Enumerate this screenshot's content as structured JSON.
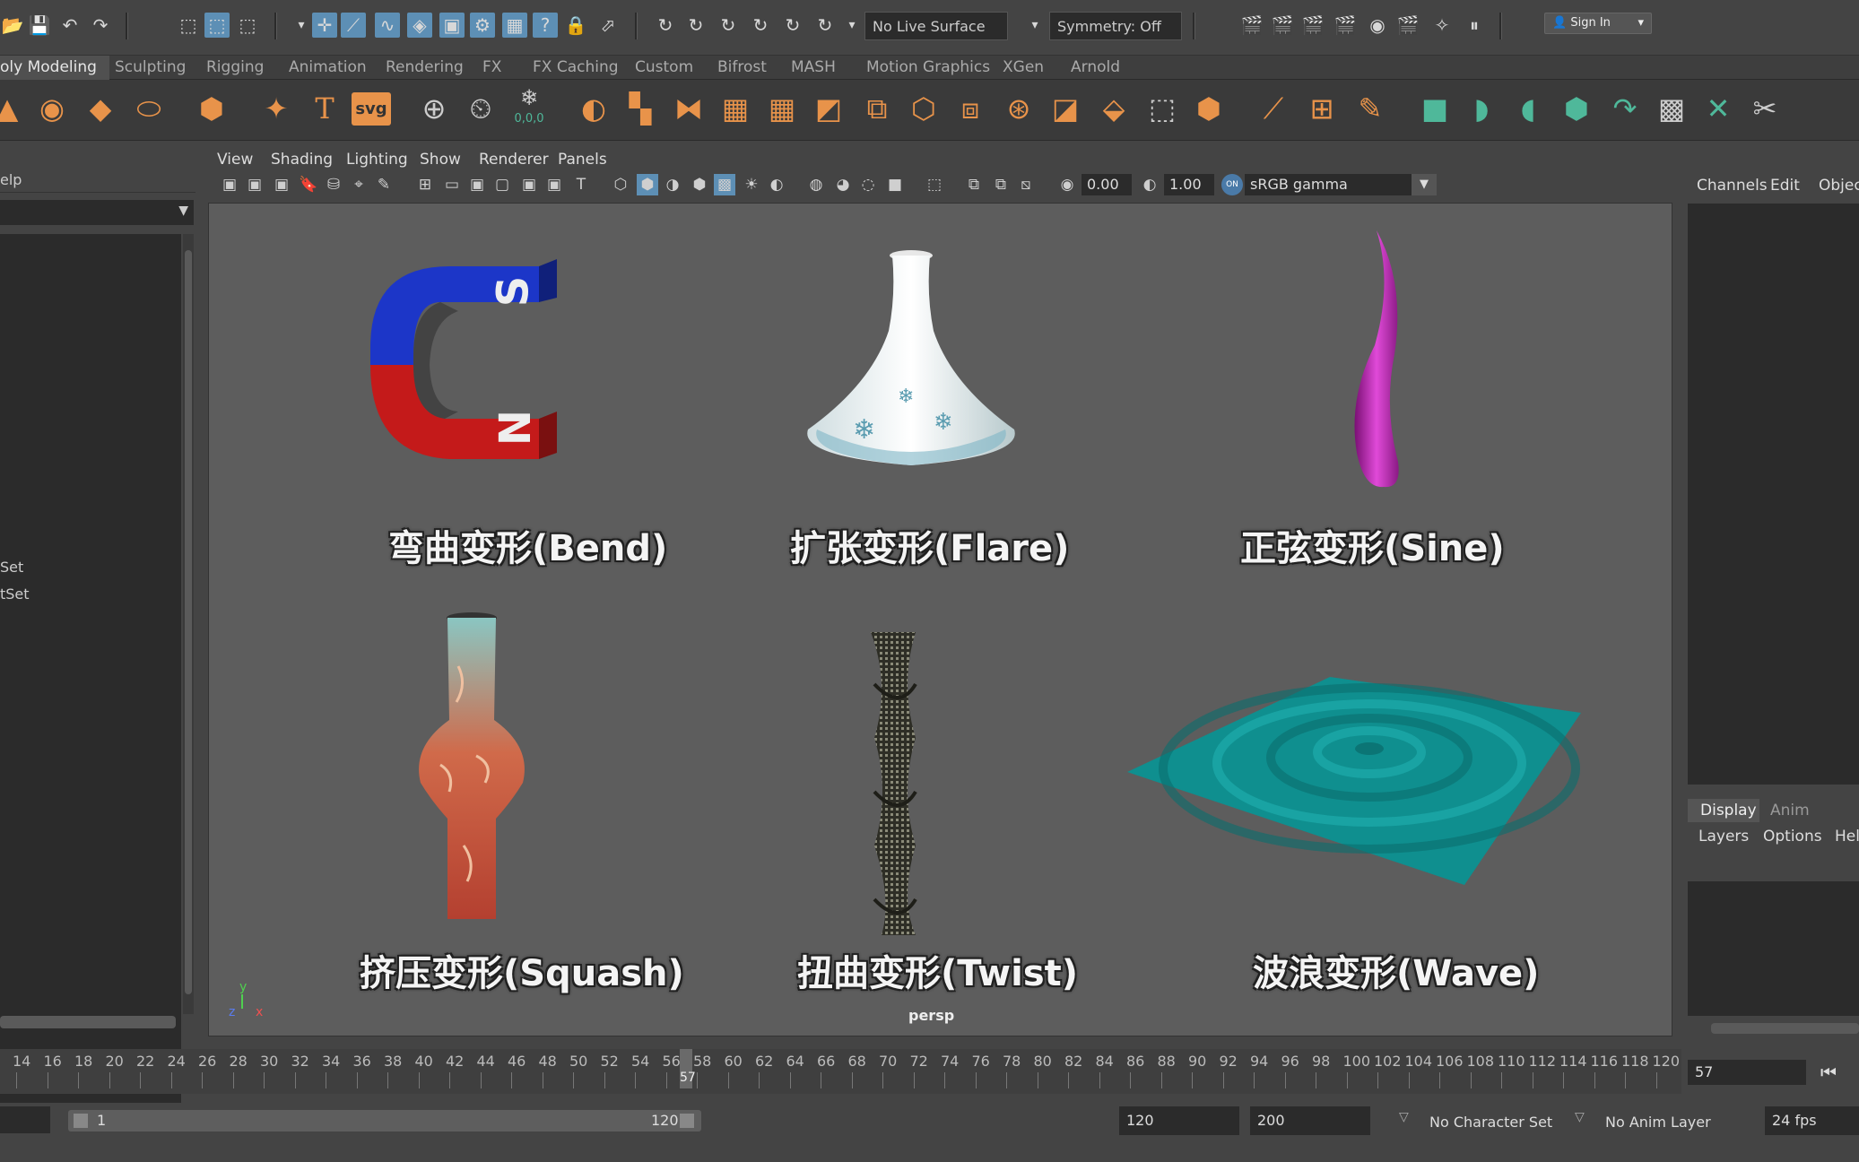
{
  "toolbar": {
    "live_surface": "No Live Surface",
    "symmetry": "Symmetry: Off",
    "sign_in": "Sign In"
  },
  "shelf_tabs": [
    "oly Modeling",
    "Sculpting",
    "Rigging",
    "Animation",
    "Rendering",
    "FX",
    "FX Caching",
    "Custom",
    "Bifrost",
    "MASH",
    "Motion Graphics",
    "XGen",
    "Arnold"
  ],
  "shelf_svg_label": "svg",
  "shelf_snowflake_value": "0,0,0",
  "left_panel": {
    "menu": "elp",
    "item1": "Set",
    "item2": "tSet"
  },
  "viewport": {
    "menus": [
      "View",
      "Shading",
      "Lighting",
      "Show",
      "Renderer",
      "Panels"
    ],
    "exposure": "0.00",
    "gamma": "1.00",
    "color_space": "sRGB gamma",
    "on_label": "ON",
    "camera": "persp",
    "axis_y": "y",
    "axis_z": "z",
    "axis_x": "x"
  },
  "deformers": {
    "bend": "弯曲变形(Bend)",
    "flare": "扩张变形(Flare)",
    "sine": "正弦变形(Sine)",
    "squash": "挤压变形(Squash)",
    "twist": "扭曲变形(Twist)",
    "wave": "波浪变形(Wave)"
  },
  "magnet": {
    "s": "S",
    "n": "N"
  },
  "channel_box": {
    "tabs": [
      "Channels",
      "Edit",
      "Objec"
    ]
  },
  "layer_editor": {
    "tabs": [
      "Display",
      "Anim"
    ],
    "menus": [
      "Layers",
      "Options",
      "Help"
    ]
  },
  "timeline": {
    "ticks": [
      "14",
      "16",
      "18",
      "20",
      "22",
      "24",
      "26",
      "28",
      "30",
      "32",
      "34",
      "36",
      "38",
      "40",
      "42",
      "44",
      "46",
      "48",
      "50",
      "52",
      "54",
      "56",
      "58",
      "60",
      "62",
      "64",
      "66",
      "68",
      "70",
      "72",
      "74",
      "76",
      "78",
      "80",
      "82",
      "84",
      "86",
      "88",
      "90",
      "92",
      "94",
      "96",
      "98",
      "100",
      "102",
      "104",
      "106",
      "108",
      "110",
      "112",
      "114",
      "116",
      "118",
      "120"
    ],
    "current_frame": "57",
    "current_frame_field": "57"
  },
  "range": {
    "start": "1",
    "end_label": "120",
    "anim_end": "120",
    "max": "200",
    "character_set": "No Character Set",
    "anim_layer": "No Anim Layer",
    "fps": "24 fps"
  },
  "colors": {
    "accent": "#5d8fb5",
    "shelf_orange": "#e8934a",
    "shelf_green": "#4fb89a",
    "magnet_blue": "#1c36c8",
    "magnet_red": "#c41a1a",
    "sine_magenta": "#b81eb0",
    "wave_teal": "#0f8f8f"
  }
}
